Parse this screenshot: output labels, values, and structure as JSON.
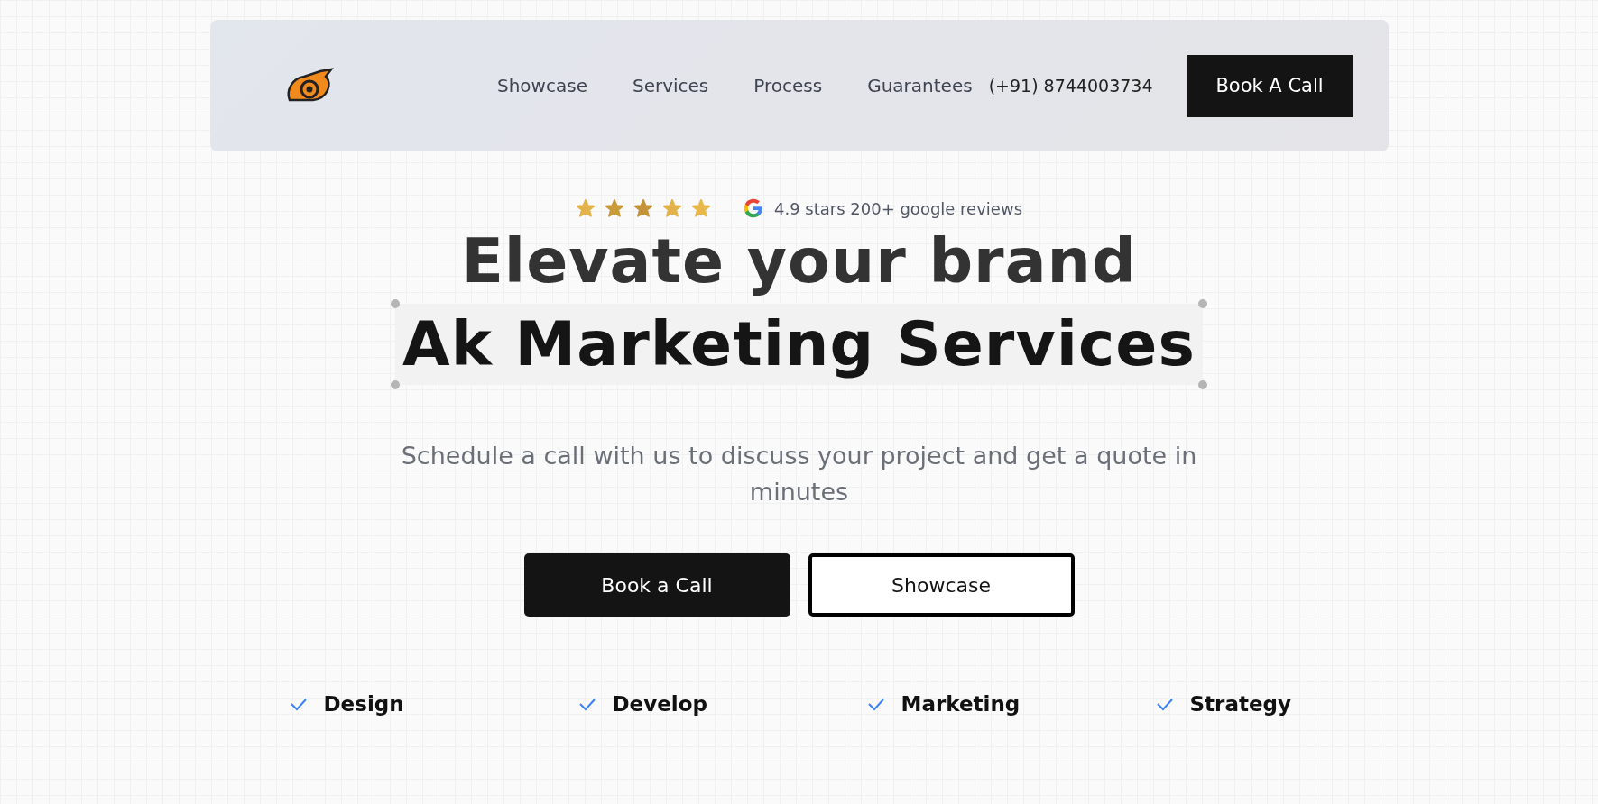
{
  "nav": {
    "links": [
      "Showcase",
      "Services",
      "Process",
      "Guarantees"
    ],
    "phone": "(+91) 8744003734",
    "cta": "Book A Call"
  },
  "rating": {
    "stars": 5,
    "text": "4.9 stars 200+ google reviews"
  },
  "headline": {
    "line_1": "Elevate your brand",
    "line_2": "Ak Marketing Services"
  },
  "subtitle": "Schedule a call with us to discuss your project and get a quote in minutes",
  "buttons": [
    {
      "label": "Book a Call",
      "kind": "primary"
    },
    {
      "label": "Showcase",
      "kind": "outline"
    }
  ],
  "features": [
    "Design",
    "Develop",
    "Marketing",
    "Strategy"
  ]
}
